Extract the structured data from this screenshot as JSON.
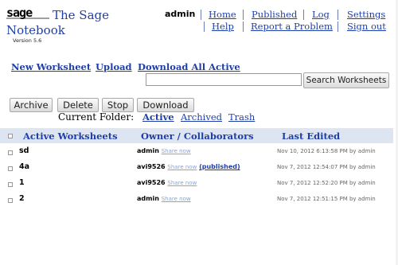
{
  "brand": {
    "logo_text": "sage",
    "title_line1": "The Sage",
    "title_line2": "Notebook",
    "version": "Version 5.6"
  },
  "top_nav": {
    "user": "admin",
    "home": "Home",
    "published": "Published",
    "log": "Log",
    "settings": "Settings",
    "help": "Help",
    "report": "Report a Problem",
    "signout": "Sign out"
  },
  "actions": {
    "new_worksheet": "New Worksheet",
    "upload": "Upload",
    "download_all": "Download All Active"
  },
  "search": {
    "value": "",
    "button": "Search Worksheets"
  },
  "toolbar": {
    "archive": "Archive",
    "delete": "Delete",
    "stop": "Stop",
    "download": "Download"
  },
  "folder": {
    "label": "Current Folder:",
    "active": "Active",
    "archived": "Archived",
    "trash": "Trash"
  },
  "table": {
    "headers": {
      "name": "Active Worksheets",
      "owner": "Owner / Collaborators",
      "edited": "Last Edited"
    },
    "rows": [
      {
        "name": "sd",
        "owner": "admin",
        "share": "Share now",
        "published": "",
        "edited": "Nov 10, 2012 6:13:58 PM by admin"
      },
      {
        "name": "4a",
        "owner": "avi9526",
        "share": "Share now",
        "published": "(published)",
        "edited": "Nov 7, 2012 12:54:07 PM by admin"
      },
      {
        "name": "1",
        "owner": "avi9526",
        "share": "Share now",
        "published": "",
        "edited": "Nov 7, 2012 12:52:20 PM by admin"
      },
      {
        "name": "2",
        "owner": "admin",
        "share": "Share now",
        "published": "",
        "edited": "Nov 7, 2012 12:51:15 PM by admin"
      }
    ]
  },
  "colors": {
    "link": "#1f3fa8",
    "header_bg": "#dde4f2"
  }
}
